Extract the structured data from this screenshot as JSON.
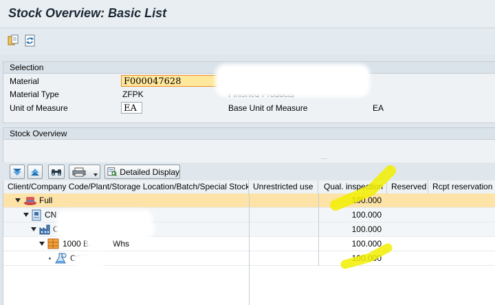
{
  "window": {
    "title": "Stock Overview: Basic List"
  },
  "toolbar": {
    "icons": [
      "copy-icon",
      "refresh-icon"
    ]
  },
  "selection": {
    "header": "Selection",
    "material_label": "Material",
    "material_value": "F000047628",
    "material_type_label": "Material Type",
    "material_type_value": "ZFPK",
    "material_type_desc": "Finished Products",
    "uom_label": "Unit of Measure",
    "uom_value": "EA",
    "base_uom_label": "Base Unit of Measure",
    "base_uom_value": "EA"
  },
  "stock_overview": {
    "header": "Stock Overview",
    "splitter": "....",
    "detailed_display_label": "Detailed Display"
  },
  "table": {
    "columns": [
      "Client/Company Code/Plant/Storage Location/Batch/Special Stock",
      "Unrestricted use",
      "Qual. inspection",
      "Reserved",
      "Rcpt reservation"
    ],
    "rows": [
      {
        "level": 0,
        "icon": "client-icon",
        "label": "Full",
        "unrestricted": "",
        "qual_inspection": "100.000"
      },
      {
        "level": 1,
        "icon": "company-code-icon",
        "label": "CN",
        "unrestricted": "",
        "qual_inspection": "100.000"
      },
      {
        "level": 2,
        "icon": "plant-icon",
        "label": "C",
        "unrestricted": "",
        "qual_inspection": "100.000"
      },
      {
        "level": 3,
        "icon": "storage-location-icon",
        "label": "1000 Ba",
        "label_suffix": "Whs",
        "unrestricted": "",
        "qual_inspection": "100.000"
      },
      {
        "level": 4,
        "icon": "batch-icon",
        "label": "CC2H",
        "unrestricted": "",
        "qual_inspection": "100.000"
      }
    ]
  }
}
